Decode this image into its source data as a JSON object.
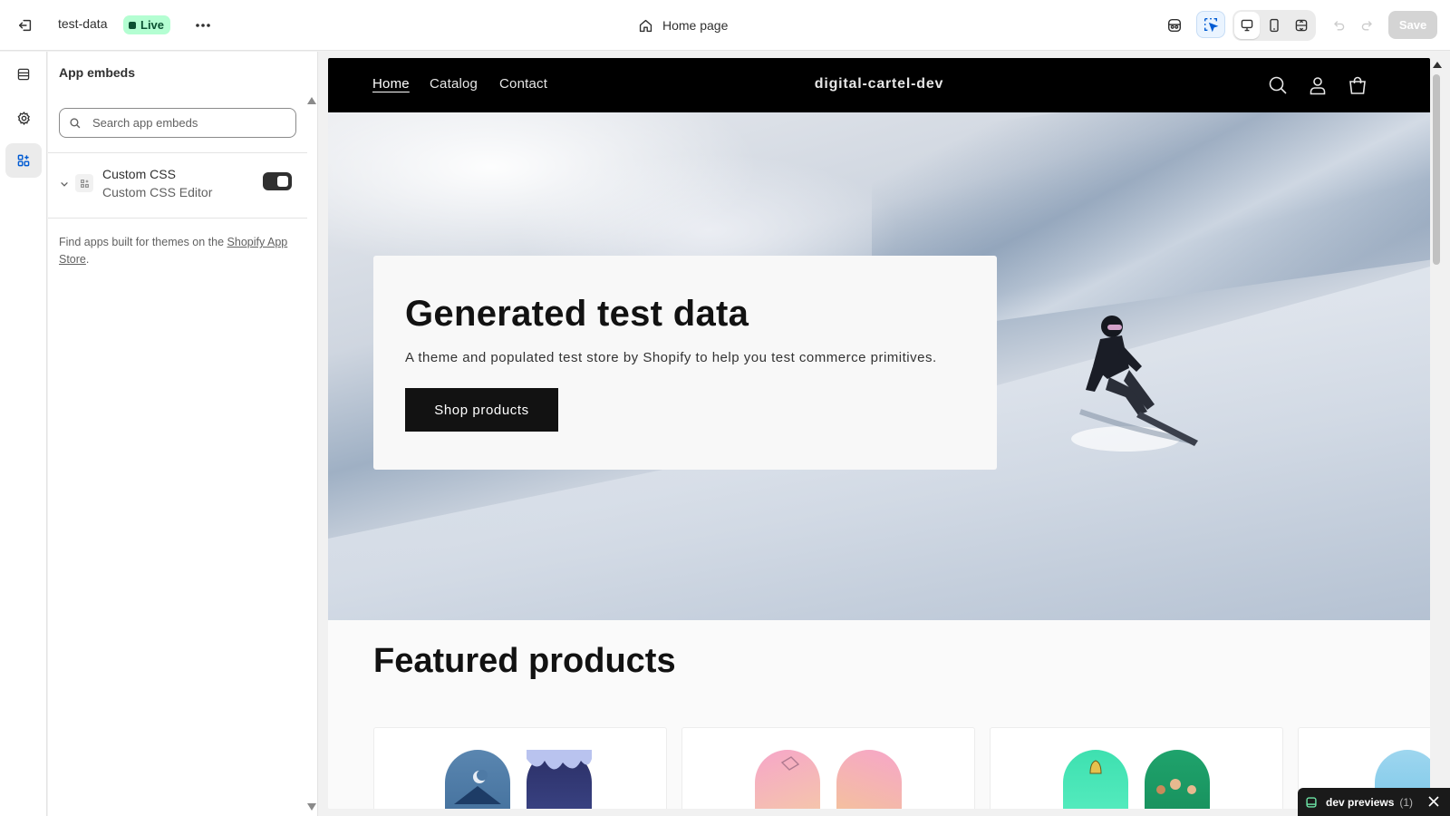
{
  "topbar": {
    "theme_name": "test-data",
    "status_badge": "Live",
    "current_page": "Home page",
    "save_label": "Save"
  },
  "panel": {
    "title": "App embeds",
    "search_placeholder": "Search app embeds",
    "embeds": [
      {
        "name": "Custom CSS",
        "description": "Custom CSS Editor",
        "enabled": true
      }
    ],
    "find_apps_text": "Find apps built for themes on the ",
    "find_apps_link": "Shopify App Store",
    "find_apps_end": "."
  },
  "store": {
    "nav": [
      "Home",
      "Catalog",
      "Contact"
    ],
    "name": "digital-cartel-dev",
    "hero": {
      "title": "Generated test data",
      "subtitle": "A theme and populated test store by Shopify to help you test commerce primitives.",
      "button": "Shop products"
    },
    "featured_title": "Featured products"
  },
  "dev_bar": {
    "label": "dev previews",
    "count": "(1)"
  },
  "colors": {
    "live_badge_bg": "#b4fed2",
    "store_header_bg": "#000000",
    "button_dark": "#121212"
  }
}
